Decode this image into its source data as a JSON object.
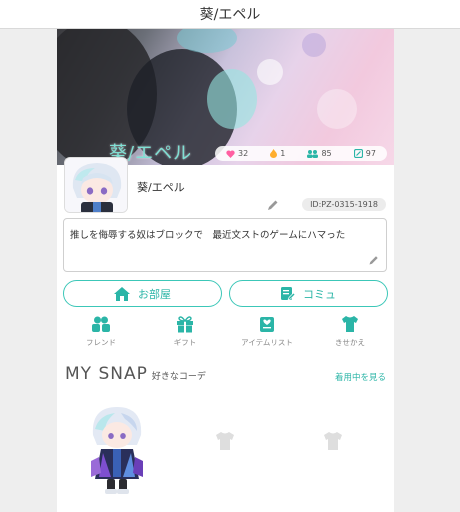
{
  "app": {
    "title": "葵/エペル"
  },
  "banner": {
    "name": "葵/エペル",
    "stats": [
      {
        "icon": "heart-icon",
        "value": "32",
        "color": "#ff5fa2"
      },
      {
        "icon": "flame-icon",
        "value": "1",
        "color": "#ffae2e"
      },
      {
        "icon": "friends-icon",
        "value": "85",
        "color": "#2bb5a7"
      },
      {
        "icon": "note-icon",
        "value": "97",
        "color": "#2bb5a7"
      }
    ]
  },
  "profile": {
    "username": "葵/エペル",
    "id": "ID:PZ-0315-1918",
    "bio": "推しを侮辱する奴はブロックで　最近文ストのゲームにハマった"
  },
  "buttons": {
    "room": "お部屋",
    "commu": "コミュ"
  },
  "nav": [
    {
      "icon": "friend-icon",
      "label": "フレンド"
    },
    {
      "icon": "gift-icon",
      "label": "ギフト"
    },
    {
      "icon": "item-list-icon",
      "label": "アイテムリスト"
    },
    {
      "icon": "dressup-icon",
      "label": "きせかえ"
    }
  ],
  "snap": {
    "title": "MY SNAP",
    "subtitle": "好きなコーデ",
    "link": "着用中を見る"
  },
  "colors": {
    "accent": "#2bb5a7",
    "heart": "#ff5fa2"
  }
}
